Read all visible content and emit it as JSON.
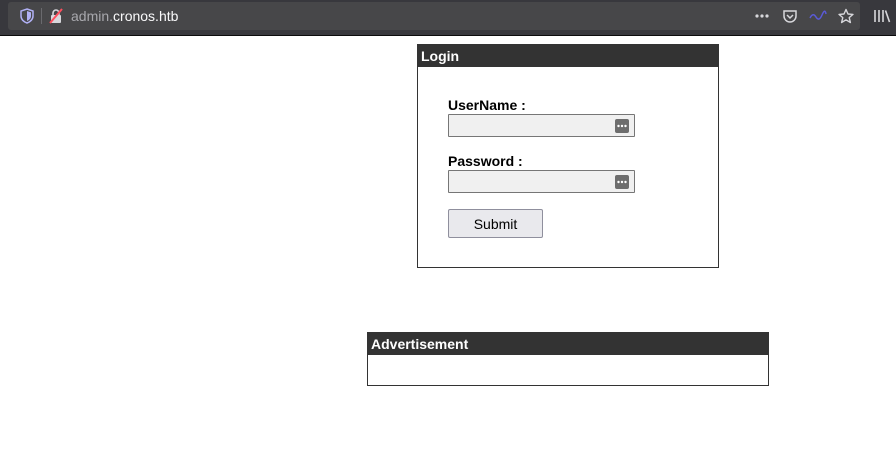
{
  "browser": {
    "url_subdomain": "admin.",
    "url_domain": "cronos.htb",
    "icons": [
      "shield-icon",
      "insecure-lock-icon",
      "more-actions-icon",
      "pocket-icon",
      "screenshot-icon",
      "bookmark-star-icon",
      "library-icon"
    ]
  },
  "login": {
    "title": "Login",
    "username_label": "UserName :",
    "username_value": "",
    "password_label": "Password :",
    "password_value": "",
    "submit_label": "Submit"
  },
  "ad": {
    "title": "Advertisement"
  },
  "colors": {
    "toolbar": "#38383d",
    "urlbar": "#474749",
    "box_header": "#333333"
  }
}
